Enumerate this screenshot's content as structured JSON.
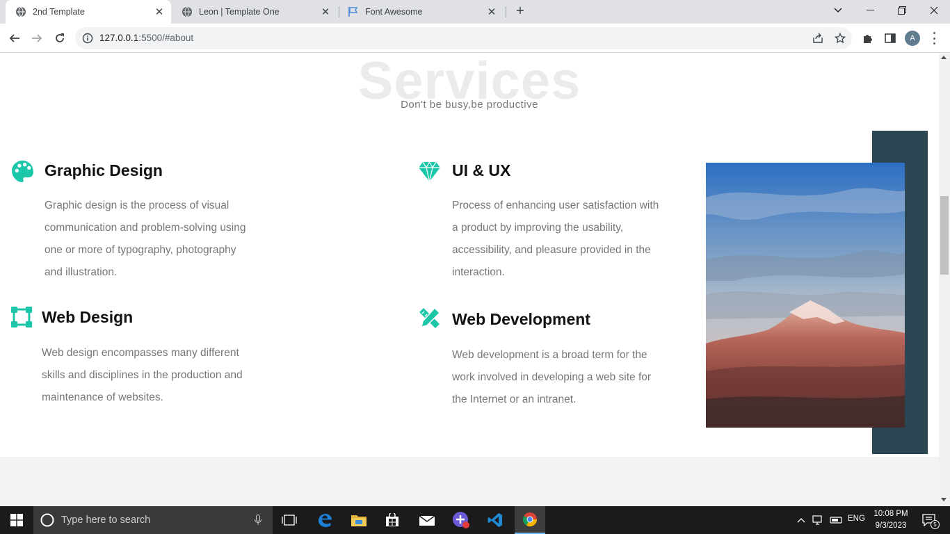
{
  "browser": {
    "tabs": [
      {
        "title": "2nd Template",
        "active": true,
        "icon": "globe-icon"
      },
      {
        "title": "Leon | Template One",
        "active": false,
        "icon": "globe-icon"
      },
      {
        "title": "Font Awesome",
        "active": false,
        "icon": "flag-icon"
      }
    ],
    "url_host": "127.0.0.1",
    "url_rest": ":5500/#about",
    "profile_initial": "A"
  },
  "services": {
    "title": "Services",
    "subtitle": "Don't be busy,be productive",
    "items": [
      {
        "icon": "palette-icon",
        "title": "Graphic Design",
        "text": "Graphic design is the process of visual communication and problem-solving using one or more of typography, photography and illustration."
      },
      {
        "icon": "gem-icon",
        "title": "UI & UX",
        "text": "Process of enhancing user satisfaction with a product by improving the usability, accessibility, and pleasure provided in the interaction."
      },
      {
        "icon": "vector-square-icon",
        "title": "Web Design",
        "text": "Web design encompasses many different skills and disciplines in the production and maintenance of websites."
      },
      {
        "icon": "pen-ruler-icon",
        "title": "Web Development",
        "text": "Web development is a broad term for the work involved in developing a web site for the Internet or an intranet."
      }
    ]
  },
  "colors": {
    "accent": "#1cc7a9",
    "image_block": "#2c4653",
    "title_watermark": "#ebebeb"
  },
  "taskbar": {
    "search_placeholder": "Type here to search",
    "language": "ENG",
    "time": "10:08 PM",
    "date": "9/3/2023",
    "notification_count": "5"
  }
}
